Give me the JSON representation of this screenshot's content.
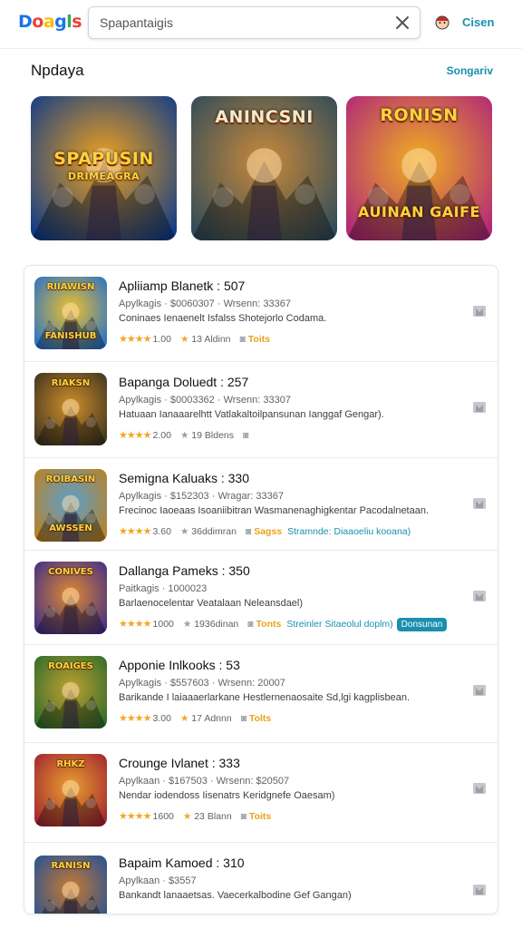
{
  "header": {
    "logo_letters": [
      {
        "ch": "D",
        "color": "#1a73e8"
      },
      {
        "ch": "o",
        "color": "#ea4335"
      },
      {
        "ch": "a",
        "color": "#fbbc05"
      },
      {
        "ch": "g",
        "color": "#1a73e8"
      },
      {
        "ch": "l",
        "color": "#34a853"
      },
      {
        "ch": "s",
        "color": "#ea4335"
      }
    ],
    "search_placeholder": "Spapantaigis",
    "signin_label": "Cisen"
  },
  "section": {
    "title": "Npdaya",
    "link": "Songariv"
  },
  "featured": [
    {
      "title": "SPAPUSIN",
      "subtitle": "DRIMEAGRA",
      "bg": [
        "#0d3a8a",
        "#f2a31b"
      ]
    },
    {
      "title": "ANINCSNI",
      "subtitle": "",
      "bg": [
        "#2d4a5a",
        "#c98a3a"
      ]
    },
    {
      "title": "RONISN",
      "subtitle": "AUINAN GAIFE",
      "bg": [
        "#b0247a",
        "#f0b020"
      ]
    }
  ],
  "apps": [
    {
      "title": "Apliiamp Blanetk : 507",
      "meta": "Apylkagis  · $0060307  ·  Wrsenn: 33367",
      "desc": "Coninaes Ienaenelt Isfalss Shotejorlo Codama.",
      "rating": "1.00",
      "ratings_label": "13 Aldinn",
      "extra": "Toits",
      "extra_style": "orange",
      "extra2": "",
      "pill": "",
      "thumb_title": "RIIAWISN",
      "thumb_sub": "FANISHUB",
      "thumb_bg": [
        "#1f6fd0",
        "#f0c12a"
      ]
    },
    {
      "title": "Bapanga Doluedt : 257",
      "meta": "Apylkagis  · $0003362  ·  Wrsenn: 33307",
      "desc": "Hatuaan Ianaaarelhtt Vatlakaltoilpansunan Ianggaf Gengar).",
      "rating": "2.00",
      "ratings_label": "19 Bldens",
      "extra": "",
      "extra_style": "",
      "extra2": "",
      "pill": "",
      "thumb_title": "RIAKSN",
      "thumb_sub": "",
      "thumb_bg": [
        "#3a3020",
        "#d0902a"
      ]
    },
    {
      "title": "Semigna Kaluaks : 330",
      "meta": "Apylkagis  · $152303  ·  Wragar: 33367",
      "desc": "Frecinoc Iaoeaas Isoaniibitran Wasmanenaghigkentar Pacodalnetaan.",
      "rating": "3.60",
      "ratings_label": "36ddimran",
      "extra": "Sagss",
      "extra_style": "orange",
      "extra2": "Stramnde: Diaaoeliu kooana)",
      "pill": "",
      "thumb_title": "ROIBASIN",
      "thumb_sub": "AWSSEN",
      "thumb_bg": [
        "#c0801a",
        "#5aa0d0"
      ]
    },
    {
      "title": "Dallanga Pameks : 350",
      "meta": "Paitkagis  · 1000023",
      "desc": "Barlaenocelentar Veatalaan Neleansdael)",
      "rating": "1000",
      "ratings_label": "1936dinan",
      "extra": "Tonts",
      "extra_style": "orange",
      "extra2": "Streinler Sitaeolul doplm)",
      "pill": "Donsunan",
      "thumb_title": "CONIVES",
      "thumb_sub": "",
      "thumb_bg": [
        "#3a2a8a",
        "#e08a30"
      ]
    },
    {
      "title": "Apponie Inlkooks : 53",
      "meta": "Apylkagis  · $557603  ·  Wrsenn: 20007",
      "desc": "Barikande I laiaaaerlarkane Hestlernenaosaite Sd,lgi kagplisbean.",
      "rating": "3.00",
      "ratings_label": "17 Adnnn",
      "extra": "Tolts",
      "extra_style": "orange",
      "extra2": "",
      "pill": "",
      "thumb_title": "ROAIGES",
      "thumb_sub": "",
      "thumb_bg": [
        "#2a6a2a",
        "#c0a030"
      ]
    },
    {
      "title": "Crounge Ivlanet : 333",
      "meta": "Apylkaan  · $167503  ·  Wrsenn: $20507",
      "desc": "Nendar iodendoss Iisenatrs Keridgnefe Oaesam)",
      "rating": "1600",
      "ratings_label": "23 Blann",
      "extra": "Toits",
      "extra_style": "orange",
      "extra2": "",
      "pill": "",
      "thumb_title": "RHKZ",
      "thumb_sub": "",
      "thumb_bg": [
        "#a02030",
        "#e8a030"
      ]
    },
    {
      "title": "Bapaim Kamoed : 310",
      "meta": "Apylkaan  · $3557",
      "desc": "Bankandt lanaaetsas. Vaecerkalbodine Gef Gangan)",
      "rating": "",
      "ratings_label": "",
      "extra": "",
      "extra_style": "",
      "extra2": "",
      "pill": "",
      "thumb_title": "RANISN",
      "thumb_sub": "",
      "thumb_bg": [
        "#1e4f9a",
        "#c87a30"
      ]
    }
  ]
}
